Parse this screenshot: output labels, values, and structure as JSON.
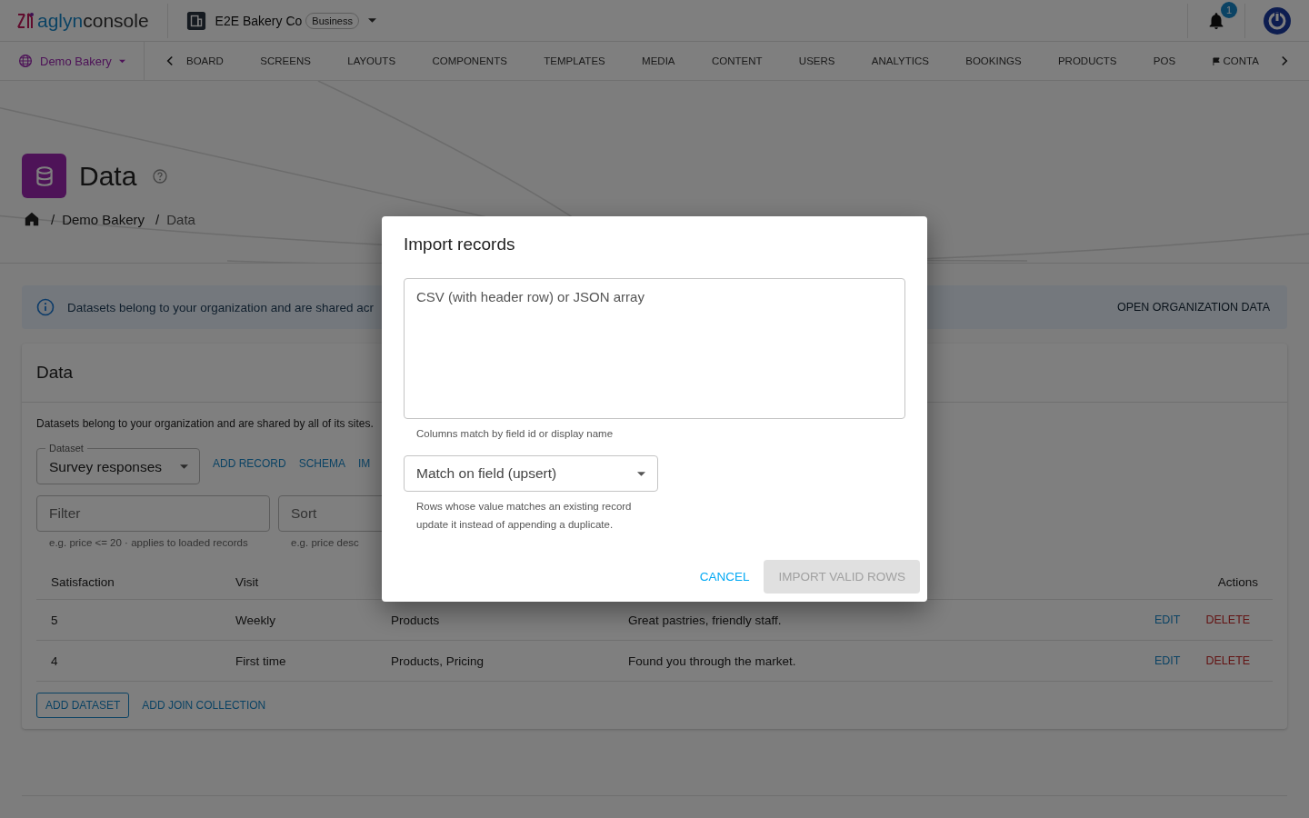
{
  "topbar": {
    "brand": "aglyn",
    "product": "console",
    "organization": "E2E Bakery Co",
    "plan_badge": "Business",
    "notification_count": "1"
  },
  "nav": {
    "site": "Demo Bakery",
    "tabs": [
      {
        "label": "BOARD",
        "kind": "plain"
      },
      {
        "label": "SCREENS",
        "kind": "plain"
      },
      {
        "label": "LAYOUTS",
        "kind": "plain"
      },
      {
        "label": "COMPONENTS",
        "kind": "plain"
      },
      {
        "label": "TEMPLATES",
        "kind": "plain"
      },
      {
        "label": "MEDIA",
        "kind": "plain"
      },
      {
        "label": "CONTENT",
        "kind": "plain"
      },
      {
        "label": "USERS",
        "kind": "plain"
      },
      {
        "label": "ANALYTICS",
        "kind": "plain"
      },
      {
        "label": "BOOKINGS",
        "kind": "plain"
      },
      {
        "label": "PRODUCTS",
        "kind": "plain"
      },
      {
        "label": "POS",
        "kind": "plain"
      },
      {
        "label": "CONTA",
        "kind": "flag"
      }
    ]
  },
  "header": {
    "title": "Data",
    "separator": "/",
    "breadcrumb": [
      "Demo Bakery",
      "Data"
    ]
  },
  "alert": {
    "text": "Datasets belong to your organization and are shared acr",
    "action": "OPEN ORGANIZATION DATA"
  },
  "card": {
    "title": "Data",
    "description": "Datasets belong to your organization and are shared by all of its sites.",
    "dataset": {
      "label": "Dataset",
      "value": "Survey responses"
    },
    "actions": [
      "ADD RECORD",
      "SCHEMA",
      "IM"
    ],
    "filter": {
      "placeholder": "Filter",
      "helper": "e.g. price <= 20 · applies to loaded records"
    },
    "sort": {
      "placeholder": "Sort",
      "helper": "e.g. price desc"
    },
    "table": {
      "columns": [
        "Satisfaction",
        "Visit",
        "Actions"
      ],
      "rows": [
        {
          "cells": [
            "5",
            "Weekly",
            "Products",
            "Great pastries, friendly staff."
          ],
          "actions": [
            "EDIT",
            "DELETE"
          ]
        },
        {
          "cells": [
            "4",
            "First time",
            "Products, Pricing",
            "Found you through the market."
          ],
          "actions": [
            "EDIT",
            "DELETE"
          ]
        }
      ]
    },
    "footer_buttons": [
      {
        "label": "ADD DATASET",
        "kind": "outlined"
      },
      {
        "label": "ADD JOIN COLLECTION",
        "kind": "text"
      }
    ]
  },
  "dialog": {
    "title": "Import records",
    "input": {
      "placeholder": "CSV (with header row) or JSON array",
      "helper": "Columns match by field id or display name"
    },
    "mode": {
      "value": "Match on field (upsert)",
      "helper": "Rows whose value matches an existing record update it instead of appending a duplicate."
    },
    "buttons": [
      {
        "label": "CANCEL",
        "disabled": false
      },
      {
        "label": "IMPORT VALID ROWS",
        "disabled": true
      }
    ]
  }
}
